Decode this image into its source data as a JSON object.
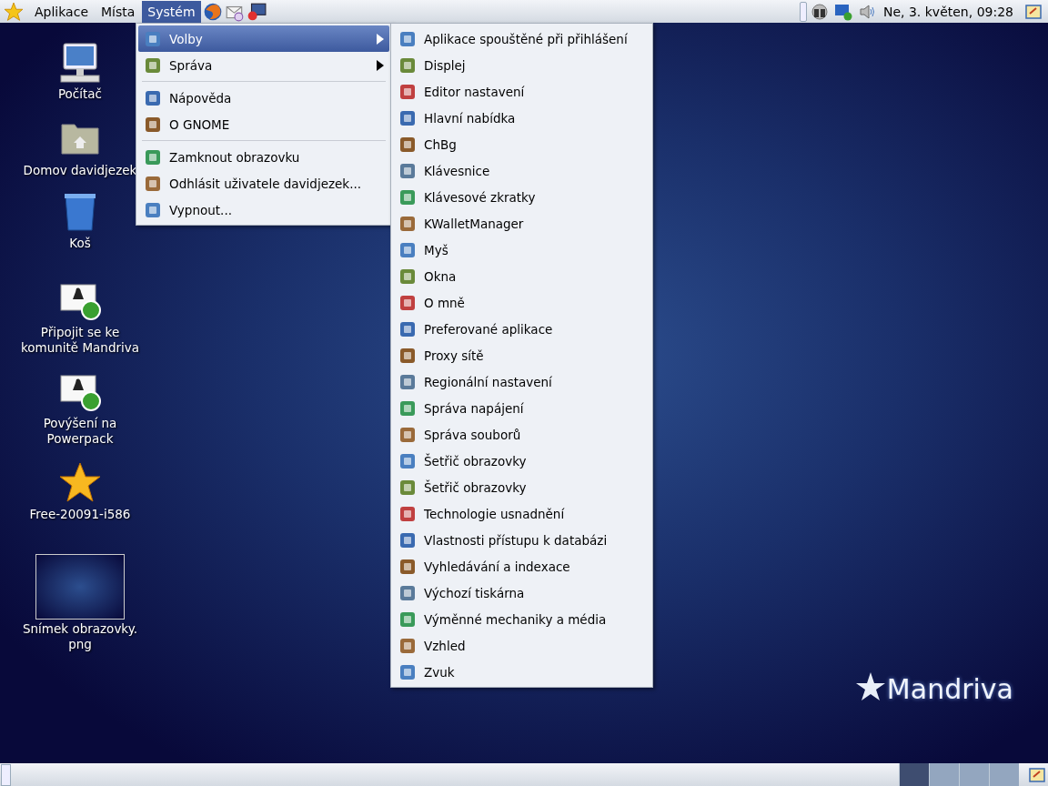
{
  "top_panel": {
    "menus": [
      {
        "label": "Aplikace",
        "selected": false
      },
      {
        "label": "Místa",
        "selected": false
      },
      {
        "label": "Systém",
        "selected": true
      }
    ],
    "clock": "Ne,  3. květen, 09:28"
  },
  "desktop_icons": [
    {
      "kind": "computer",
      "label": "Počítač"
    },
    {
      "kind": "folder",
      "label": "Domov davidjezek"
    },
    {
      "kind": "trash",
      "label": "Koš"
    },
    {
      "kind": "document",
      "label": "Připojit se ke komunitě Mandriva"
    },
    {
      "kind": "document",
      "label": "Povýšení na Powerpack"
    },
    {
      "kind": "star",
      "label": "Free-20091-i586"
    },
    {
      "kind": "screenshot",
      "label": "Snímek obrazovky. png"
    }
  ],
  "system_menu": {
    "groups": [
      [
        {
          "label": "Volby",
          "selected": true,
          "submenu": true
        },
        {
          "label": "Správa",
          "selected": false,
          "submenu": true
        }
      ],
      [
        {
          "label": "Nápověda",
          "selected": false,
          "submenu": false
        },
        {
          "label": "O GNOME",
          "selected": false,
          "submenu": false
        }
      ],
      [
        {
          "label": "Zamknout obrazovku",
          "selected": false,
          "submenu": false
        },
        {
          "label": "Odhlásit uživatele davidjezek...",
          "selected": false,
          "submenu": false
        },
        {
          "label": "Vypnout...",
          "selected": false,
          "submenu": false
        }
      ]
    ]
  },
  "preferences_submenu": [
    "Aplikace spouštěné při přihlášení",
    "Displej",
    "Editor nastavení",
    "Hlavní nabídka",
    "ChBg",
    "Klávesnice",
    "Klávesové zkratky",
    "KWalletManager",
    "Myš",
    "Okna",
    "O mně",
    "Preferované aplikace",
    "Proxy sítě",
    "Regionální nastavení",
    "Správa napájení",
    "Správa souborů",
    "Šetřič obrazovky",
    "Šetřič obrazovky",
    "Technologie usnadnění",
    "Vlastnosti přístupu k databázi",
    "Vyhledávání a indexace",
    "Výchozí tiskárna",
    "Výměnné mechaniky a média",
    "Vzhled",
    "Zvuk"
  ],
  "logo": "Mandriva",
  "bottom_panel": {
    "workspaces": [
      {
        "selected": true
      },
      {
        "selected": false
      },
      {
        "selected": false
      },
      {
        "selected": false
      }
    ]
  }
}
